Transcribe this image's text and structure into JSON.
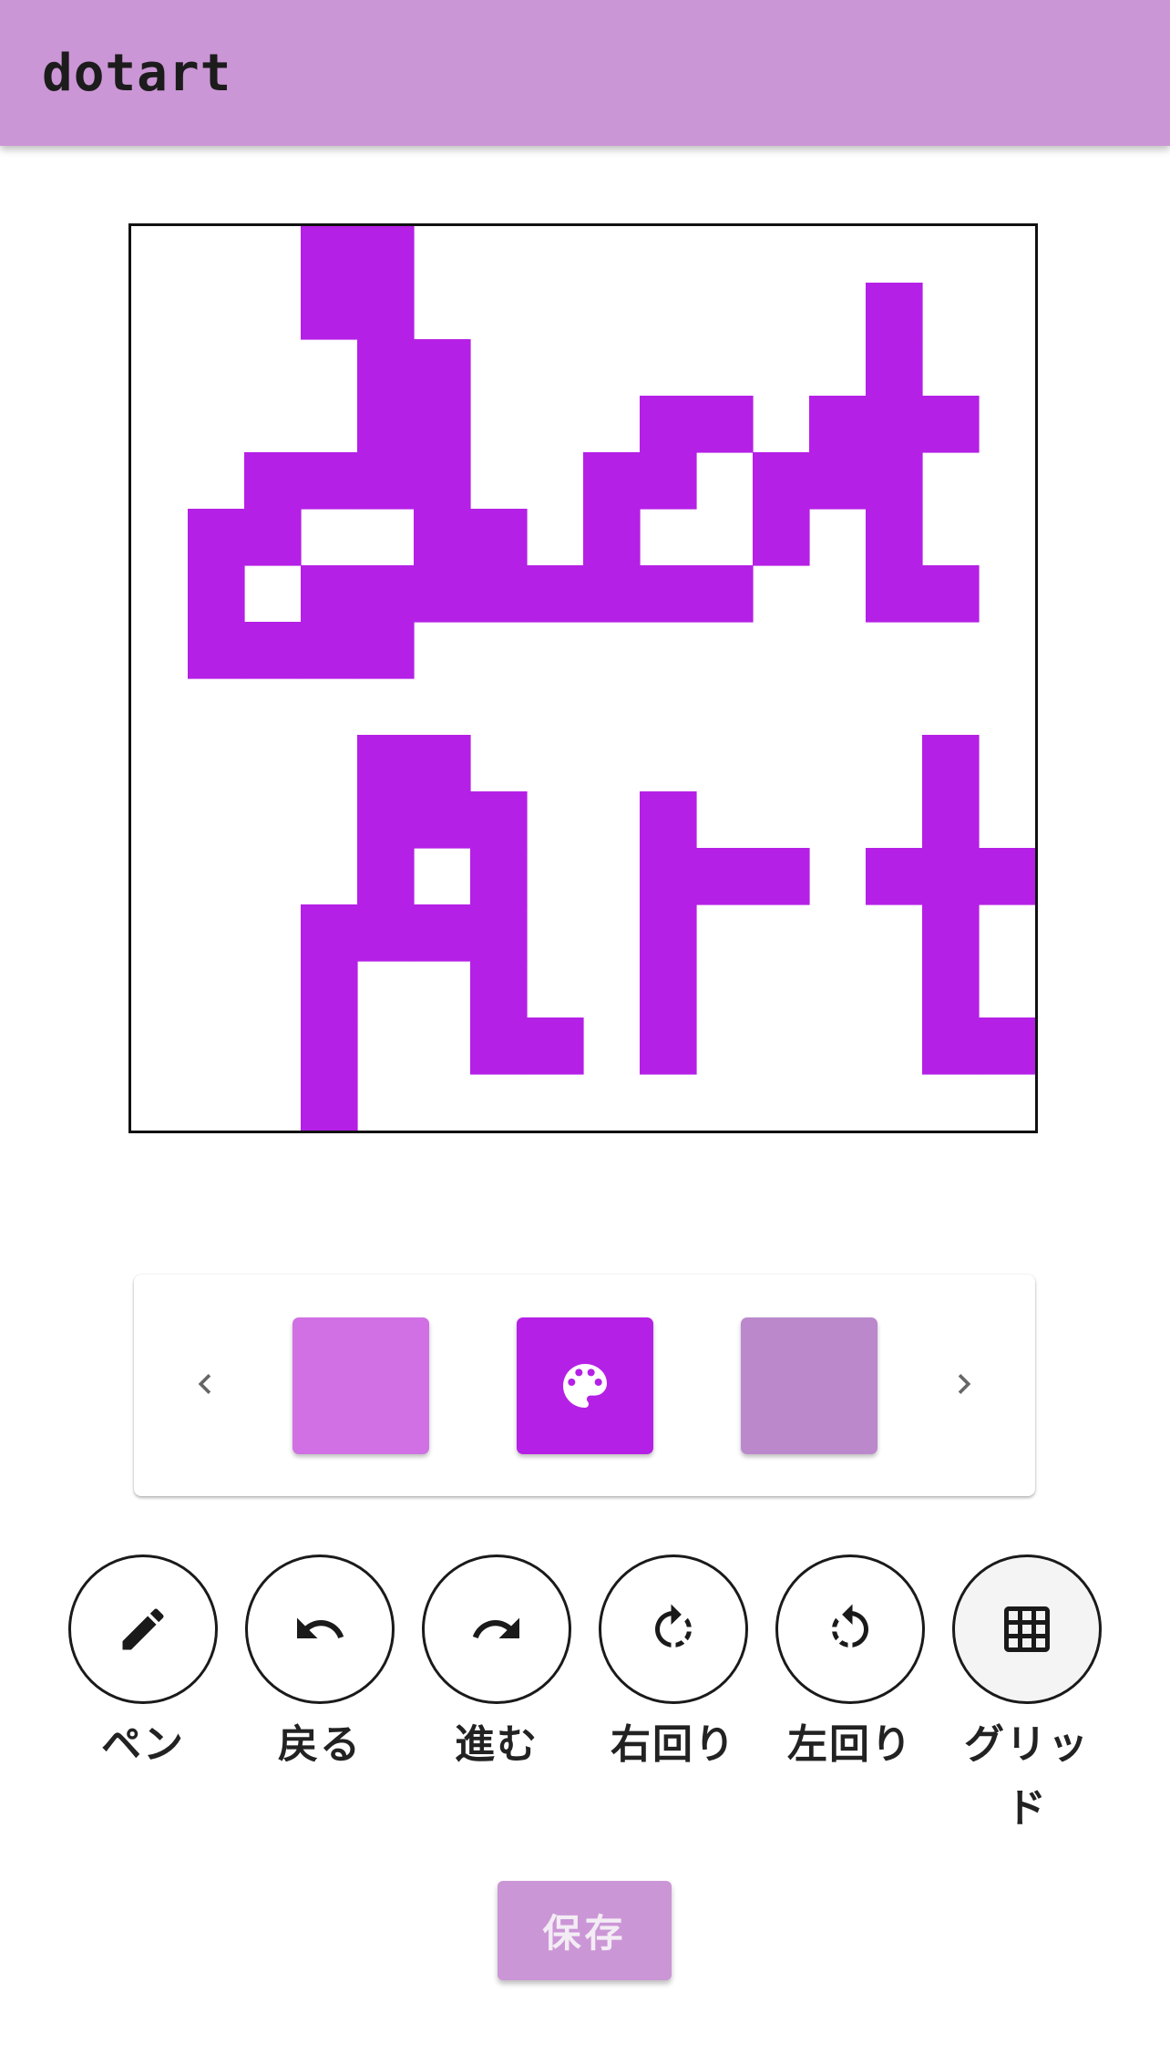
{
  "app": {
    "title": "dotart",
    "appbar_color": "#cb96d6"
  },
  "canvas": {
    "grid_size": 16,
    "pixel_color": "#b520e6",
    "painted_cells": [
      [
        3,
        0
      ],
      [
        4,
        0
      ],
      [
        3,
        1
      ],
      [
        4,
        1
      ],
      [
        13,
        1
      ],
      [
        4,
        2
      ],
      [
        5,
        2
      ],
      [
        13,
        2
      ],
      [
        4,
        3
      ],
      [
        5,
        3
      ],
      [
        9,
        3
      ],
      [
        10,
        3
      ],
      [
        12,
        3
      ],
      [
        13,
        3
      ],
      [
        14,
        3
      ],
      [
        2,
        4
      ],
      [
        3,
        4
      ],
      [
        4,
        4
      ],
      [
        5,
        4
      ],
      [
        8,
        4
      ],
      [
        9,
        4
      ],
      [
        11,
        4
      ],
      [
        12,
        4
      ],
      [
        13,
        4
      ],
      [
        1,
        5
      ],
      [
        2,
        5
      ],
      [
        5,
        5
      ],
      [
        6,
        5
      ],
      [
        8,
        5
      ],
      [
        11,
        5
      ],
      [
        13,
        5
      ],
      [
        1,
        6
      ],
      [
        3,
        6
      ],
      [
        4,
        6
      ],
      [
        5,
        6
      ],
      [
        6,
        6
      ],
      [
        7,
        6
      ],
      [
        8,
        6
      ],
      [
        9,
        6
      ],
      [
        10,
        6
      ],
      [
        13,
        6
      ],
      [
        14,
        6
      ],
      [
        1,
        7
      ],
      [
        2,
        7
      ],
      [
        3,
        7
      ],
      [
        4,
        7
      ],
      [
        4,
        9
      ],
      [
        5,
        9
      ],
      [
        14,
        9
      ],
      [
        4,
        10
      ],
      [
        5,
        10
      ],
      [
        6,
        10
      ],
      [
        9,
        10
      ],
      [
        14,
        10
      ],
      [
        4,
        11
      ],
      [
        6,
        11
      ],
      [
        9,
        11
      ],
      [
        10,
        11
      ],
      [
        11,
        11
      ],
      [
        13,
        11
      ],
      [
        14,
        11
      ],
      [
        15,
        11
      ],
      [
        3,
        12
      ],
      [
        4,
        12
      ],
      [
        5,
        12
      ],
      [
        6,
        12
      ],
      [
        9,
        12
      ],
      [
        14,
        12
      ],
      [
        3,
        13
      ],
      [
        6,
        13
      ],
      [
        9,
        13
      ],
      [
        14,
        13
      ],
      [
        3,
        14
      ],
      [
        6,
        14
      ],
      [
        7,
        14
      ],
      [
        9,
        14
      ],
      [
        14,
        14
      ],
      [
        15,
        14
      ],
      [
        3,
        15
      ]
    ]
  },
  "palette": {
    "swatches": [
      {
        "color": "#d070e4",
        "selected": false
      },
      {
        "color": "#b520e6",
        "selected": true,
        "icon": "palette-icon"
      },
      {
        "color": "#bb88cc",
        "selected": false
      }
    ],
    "prev_icon": "chevron-left-icon",
    "next_icon": "chevron-right-icon"
  },
  "tools": [
    {
      "id": "pen",
      "label": "ペン",
      "icon": "pencil-icon"
    },
    {
      "id": "undo",
      "label": "戻る",
      "icon": "undo-icon"
    },
    {
      "id": "redo",
      "label": "進む",
      "icon": "redo-icon"
    },
    {
      "id": "rotate-right",
      "label": "右回り",
      "icon": "rotate-right-icon"
    },
    {
      "id": "rotate-left",
      "label": "左回り",
      "icon": "rotate-left-icon"
    },
    {
      "id": "grid",
      "label": "グリッド",
      "icon": "grid-icon",
      "active": true
    }
  ],
  "save": {
    "label": "保存"
  }
}
